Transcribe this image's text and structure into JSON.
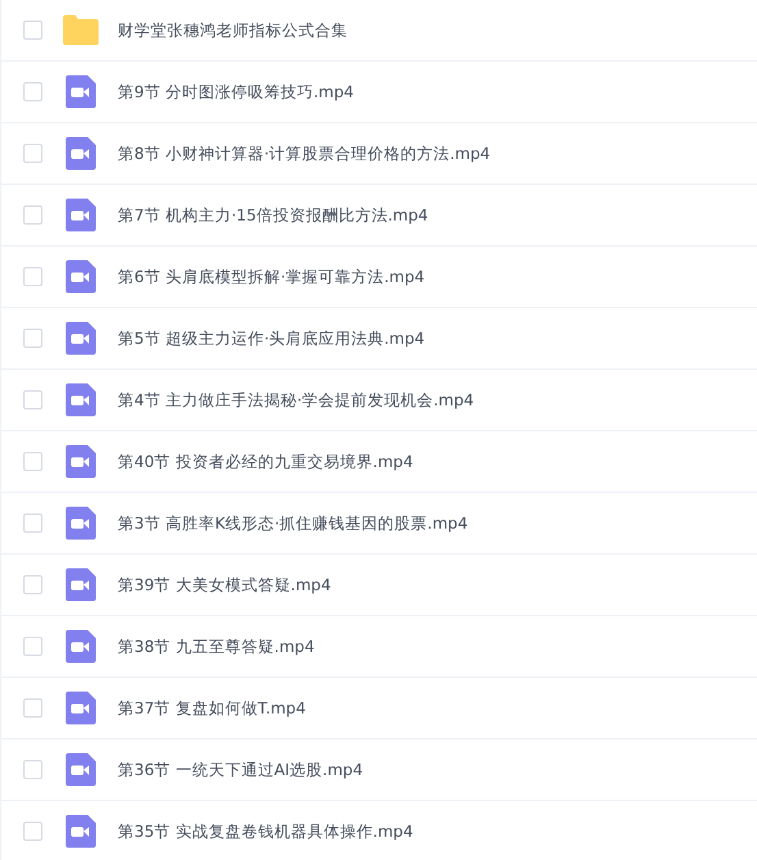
{
  "files": [
    {
      "kind": "folder",
      "name": "财学堂张穗鸿老师指标公式合集",
      "checked": false
    },
    {
      "kind": "video",
      "name": "第9节 分时图涨停吸筹技巧.mp4",
      "checked": false
    },
    {
      "kind": "video",
      "name": "第8节 小财神计算器·计算股票合理价格的方法.mp4",
      "checked": false
    },
    {
      "kind": "video",
      "name": "第7节 机构主力·15倍投资报酬比方法.mp4",
      "checked": false
    },
    {
      "kind": "video",
      "name": "第6节 头肩底模型拆解·掌握可靠方法.mp4",
      "checked": false
    },
    {
      "kind": "video",
      "name": "第5节 超级主力运作·头肩底应用法典.mp4",
      "checked": false
    },
    {
      "kind": "video",
      "name": "第4节 主力做庄手法揭秘·学会提前发现机会.mp4",
      "checked": false
    },
    {
      "kind": "video",
      "name": "第40节 投资者必经的九重交易境界.mp4",
      "checked": false
    },
    {
      "kind": "video",
      "name": "第3节 高胜率K线形态·抓住赚钱基因的股票.mp4",
      "checked": false
    },
    {
      "kind": "video",
      "name": "第39节 大美女模式答疑.mp4",
      "checked": false
    },
    {
      "kind": "video",
      "name": "第38节 九五至尊答疑.mp4",
      "checked": false
    },
    {
      "kind": "video",
      "name": "第37节 复盘如何做T.mp4",
      "checked": false
    },
    {
      "kind": "video",
      "name": "第36节 一统天下通过AI选股.mp4",
      "checked": false
    },
    {
      "kind": "video",
      "name": "第35节 实战复盘卷钱机器具体操作.mp4",
      "checked": false
    }
  ]
}
